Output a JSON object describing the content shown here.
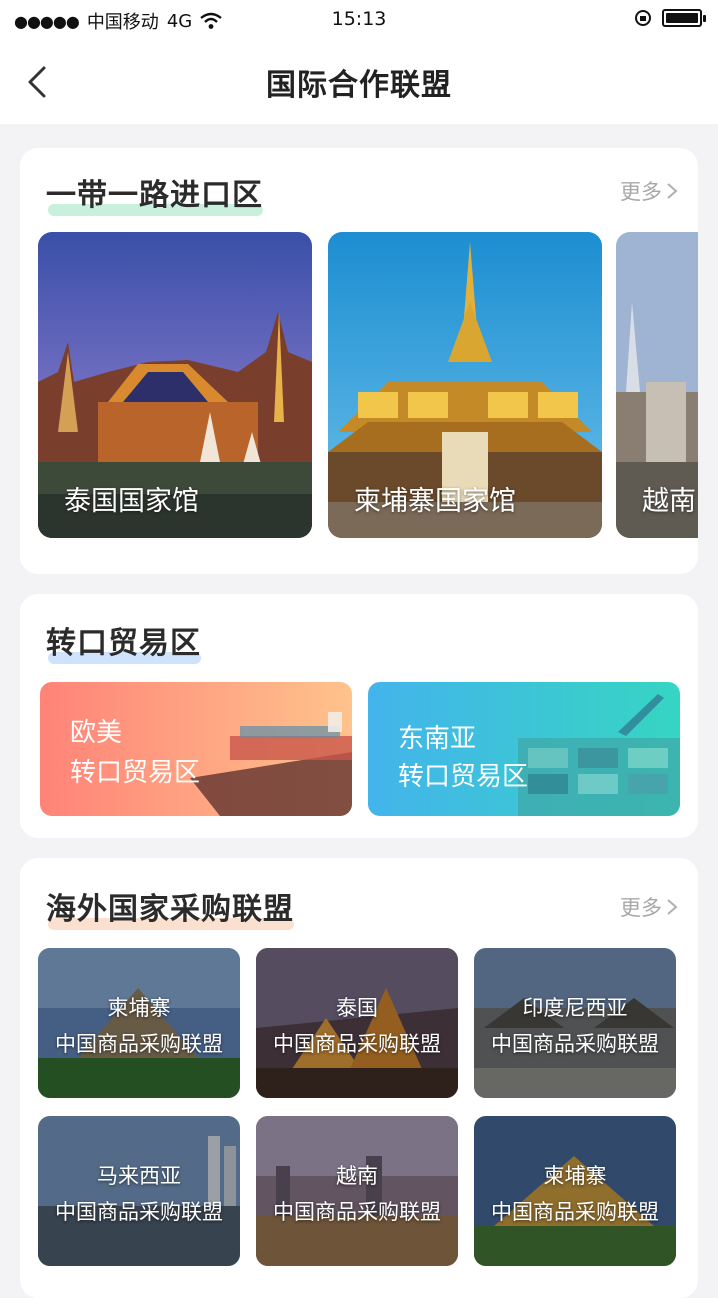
{
  "status_bar": {
    "signal_dots": "●●●●●",
    "carrier": "中国移动",
    "network": "4G",
    "time": "15:13"
  },
  "nav": {
    "title": "国际合作联盟"
  },
  "belt_road": {
    "title": "一带一路进口区",
    "more_label": "更多",
    "pavilions": [
      {
        "label": "泰国国家馆"
      },
      {
        "label": "柬埔寨国家馆"
      },
      {
        "label": "越南"
      }
    ]
  },
  "entrepot": {
    "title": "转口贸易区",
    "tiles": [
      {
        "line1": "欧美",
        "line2": "转口贸易区"
      },
      {
        "line1": "东南亚",
        "line2": "转口贸易区"
      }
    ]
  },
  "overseas": {
    "title": "海外国家采购联盟",
    "more_label": "更多",
    "tiles": [
      {
        "country": "柬埔寨",
        "subtitle": "中国商品采购联盟"
      },
      {
        "country": "泰国",
        "subtitle": "中国商品采购联盟"
      },
      {
        "country": "印度尼西亚",
        "subtitle": "中国商品采购联盟"
      },
      {
        "country": "马来西亚",
        "subtitle": "中国商品采购联盟"
      },
      {
        "country": "越南",
        "subtitle": "中国商品采购联盟"
      },
      {
        "country": "柬埔寨",
        "subtitle": "中国商品采购联盟"
      }
    ]
  },
  "colors": {
    "green_highlight": "#c9f0dd",
    "blue_highlight": "#cfe3fb",
    "orange_highlight": "#fbe0cf",
    "coral_tile": "#ff8d7e",
    "teal_tile": "#3ccbd4"
  }
}
